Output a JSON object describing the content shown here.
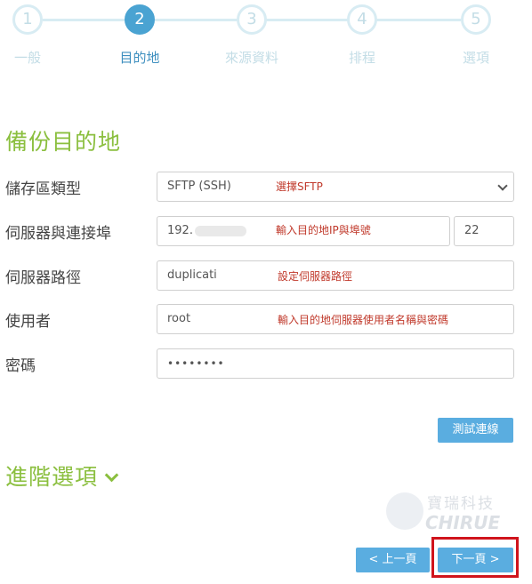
{
  "steps": [
    {
      "num": "1",
      "label": "一般"
    },
    {
      "num": "2",
      "label": "目的地"
    },
    {
      "num": "3",
      "label": "來源資料"
    },
    {
      "num": "4",
      "label": "排程"
    },
    {
      "num": "5",
      "label": "選項"
    }
  ],
  "section_title": "備份目的地",
  "form": {
    "storage_type": {
      "label": "儲存區類型",
      "value": "SFTP (SSH)",
      "note": "選擇SFTP"
    },
    "server": {
      "label": "伺服器與連接埠",
      "value": "192.",
      "note": "輸入目的地IP與埠號",
      "port": "22"
    },
    "path": {
      "label": "伺服器路徑",
      "value": "duplicati",
      "note": "設定伺服器路徑"
    },
    "user": {
      "label": "使用者",
      "value": "root",
      "note": "輸入目的地伺服器使用者名稱與密碼"
    },
    "password": {
      "label": "密碼",
      "value": "••••••••"
    }
  },
  "test_button": "測試連線",
  "advanced": "進階選項",
  "watermark": {
    "zh": "寶瑞科技",
    "en": "CHIRUE"
  },
  "nav": {
    "prev": "< 上一頁",
    "next": "下一頁 >"
  },
  "colors": {
    "accent": "#5aade0",
    "green": "#8bbf3f",
    "note": "#c0392b",
    "highlight": "#d0141c"
  }
}
